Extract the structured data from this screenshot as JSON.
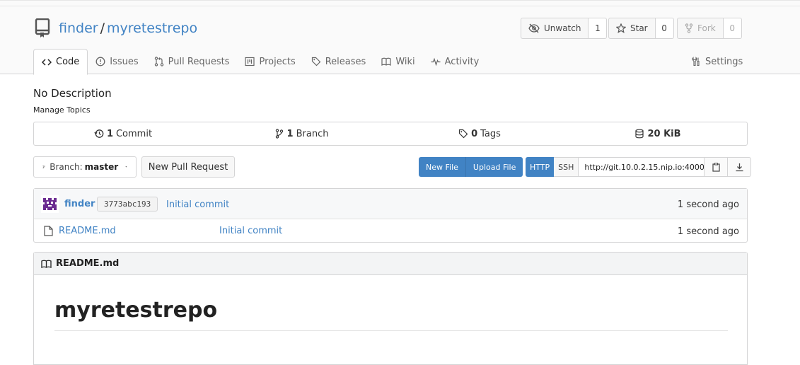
{
  "repo": {
    "owner": "finder",
    "separator": "/",
    "name": "myretestrepo"
  },
  "actions": {
    "watch": {
      "label": "Unwatch",
      "count": "1"
    },
    "star": {
      "label": "Star",
      "count": "0"
    },
    "fork": {
      "label": "Fork",
      "count": "0"
    }
  },
  "tabs": [
    {
      "label": "Code",
      "icon": "code-icon",
      "active": true
    },
    {
      "label": "Issues",
      "icon": "issue-icon"
    },
    {
      "label": "Pull Requests",
      "icon": "pull-request-icon"
    },
    {
      "label": "Projects",
      "icon": "project-icon"
    },
    {
      "label": "Releases",
      "icon": "tag-icon"
    },
    {
      "label": "Wiki",
      "icon": "book-icon"
    },
    {
      "label": "Activity",
      "icon": "pulse-icon"
    }
  ],
  "settings_tab": {
    "label": "Settings",
    "icon": "tools-icon"
  },
  "description": "No Description",
  "manage_topics": "Manage Topics",
  "stats": {
    "commits": {
      "count": "1",
      "label": "Commit"
    },
    "branches": {
      "count": "1",
      "label": "Branch"
    },
    "tags": {
      "count": "0",
      "label": "Tags"
    },
    "size": {
      "value": "20 KiB"
    }
  },
  "branch_selector": {
    "prefix": "Branch:",
    "value": "master"
  },
  "new_pull_request": "New Pull Request",
  "file_buttons": {
    "new_file": "New File",
    "upload_file": "Upload File"
  },
  "clone": {
    "http": "HTTP",
    "ssh": "SSH",
    "url": "http://git.10.0.2.15.nip.io:4000/"
  },
  "latest_commit": {
    "author": "finder",
    "sha": "3773abc193",
    "message": "Initial commit",
    "age": "1 second ago"
  },
  "files": [
    {
      "name": "README.md",
      "message": "Initial commit",
      "age": "1 second ago"
    }
  ],
  "readme": {
    "filename": "README.md",
    "heading": "myretestrepo"
  },
  "colors": {
    "accent": "#4183c4",
    "avatar": "#6b2c91"
  }
}
